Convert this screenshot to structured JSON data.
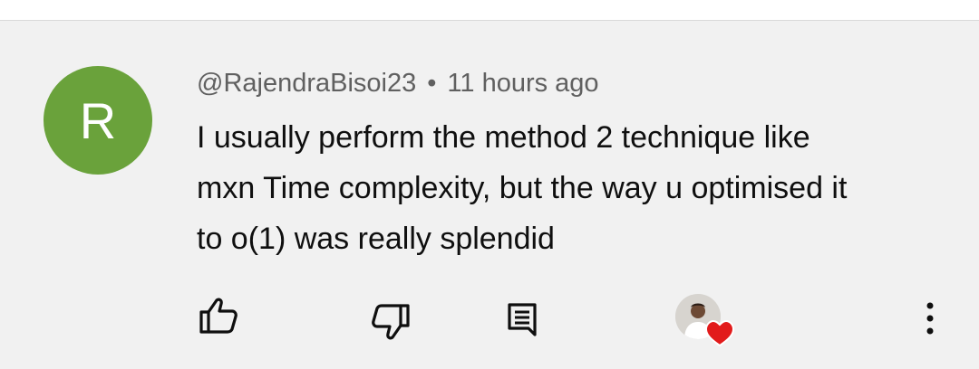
{
  "comment": {
    "avatar_letter": "R",
    "avatar_color": "#6aa23b",
    "author": "@RajendraBisoi23",
    "separator": "•",
    "timestamp": "11 hours ago",
    "text_lines": [
      "I usually perform the method 2 technique like",
      "mxn Time complexity, but the way u optimised it",
      "to o(1) was really splendid"
    ]
  },
  "actions": {
    "like_icon": "thumb-up-icon",
    "dislike_icon": "thumb-down-icon",
    "reply_icon": "reply-comment-icon",
    "creator_heart_icon": "heart-icon",
    "heart_color": "#e21b1b",
    "more_icon": "more-vertical-icon"
  }
}
